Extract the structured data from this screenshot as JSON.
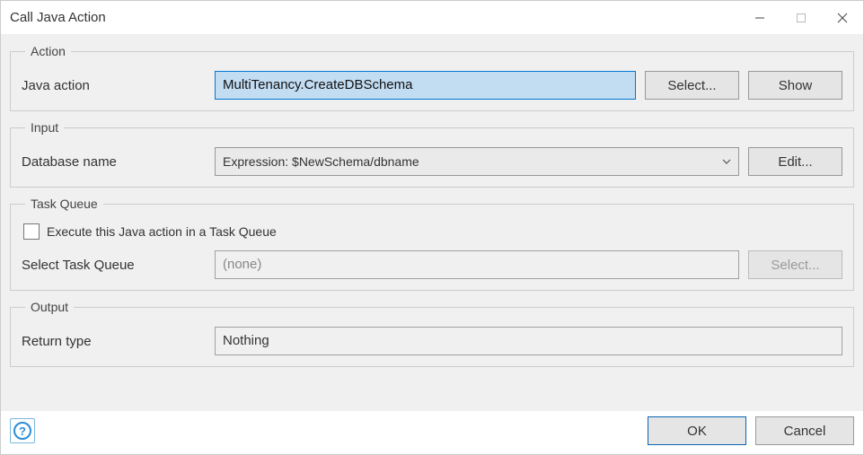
{
  "window": {
    "title": "Call Java Action"
  },
  "action": {
    "legend": "Action",
    "java_action_label": "Java action",
    "java_action_value": "MultiTenancy.CreateDBSchema",
    "select_btn": "Select...",
    "show_btn": "Show"
  },
  "input": {
    "legend": "Input",
    "dbname_label": "Database name",
    "dbname_value": "Expression: $NewSchema/dbname",
    "edit_btn": "Edit..."
  },
  "taskqueue": {
    "legend": "Task Queue",
    "checkbox_label": "Execute this Java action in a Task Queue",
    "checked": false,
    "select_label": "Select Task Queue",
    "select_value": "(none)",
    "select_btn": "Select..."
  },
  "output": {
    "legend": "Output",
    "return_type_label": "Return type",
    "return_type_value": "Nothing"
  },
  "buttons": {
    "ok": "OK",
    "cancel": "Cancel"
  }
}
